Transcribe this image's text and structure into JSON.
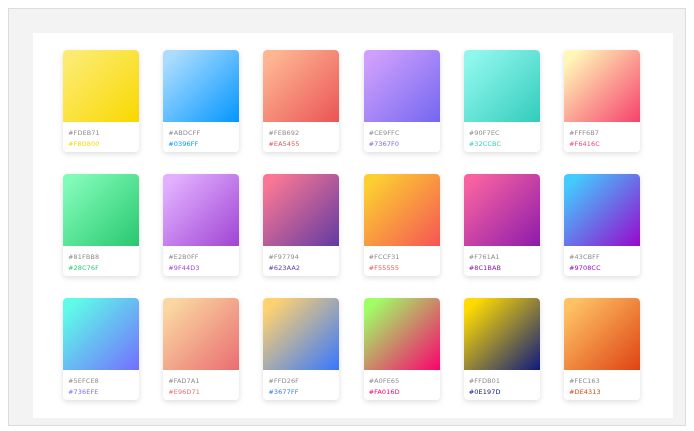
{
  "gradients": [
    {
      "from": "#FDEB71",
      "to": "#F8D800"
    },
    {
      "from": "#ABDCFF",
      "to": "#0396FF"
    },
    {
      "from": "#FEB692",
      "to": "#EA5455"
    },
    {
      "from": "#CE9FFC",
      "to": "#7367F0"
    },
    {
      "from": "#90F7EC",
      "to": "#32CCBC"
    },
    {
      "from": "#FFF6B7",
      "to": "#F6416C"
    },
    {
      "from": "#81FBB8",
      "to": "#28C76F"
    },
    {
      "from": "#E2B0FF",
      "to": "#9F44D3"
    },
    {
      "from": "#F97794",
      "to": "#623AA2"
    },
    {
      "from": "#FCCF31",
      "to": "#F55555"
    },
    {
      "from": "#F761A1",
      "to": "#8C1BAB"
    },
    {
      "from": "#43CBFF",
      "to": "#9708CC"
    },
    {
      "from": "#5EFCE8",
      "to": "#736EFE"
    },
    {
      "from": "#FAD7A1",
      "to": "#E96D71"
    },
    {
      "from": "#FFD26F",
      "to": "#3677FF"
    },
    {
      "from": "#A0FE65",
      "to": "#FA016D"
    },
    {
      "from": "#FFDB01",
      "to": "#0E197D"
    },
    {
      "from": "#FEC163",
      "to": "#DE4313"
    }
  ]
}
